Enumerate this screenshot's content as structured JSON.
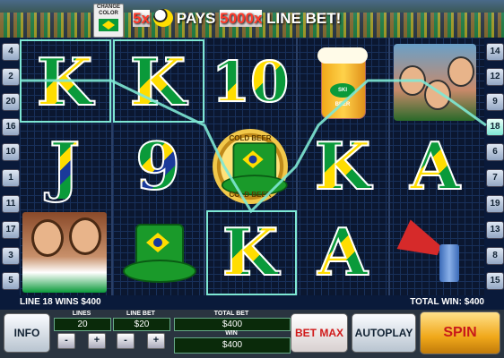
{
  "header": {
    "change_color_label": "CHANGE COLOR",
    "banner_multiplier": "5x",
    "banner_pays": "PAYS",
    "banner_amount": "5000x",
    "banner_suffix": "LINE BET!"
  },
  "paylines": {
    "left": [
      "4",
      "2",
      "20",
      "16",
      "10",
      "1",
      "11",
      "17",
      "3",
      "5"
    ],
    "right": [
      "14",
      "12",
      "9",
      "18",
      "6",
      "7",
      "19",
      "13",
      "8",
      "15"
    ]
  },
  "reels": [
    [
      "K",
      "J",
      "girls-fans"
    ],
    [
      "K",
      "9",
      "green-hat"
    ],
    [
      "10",
      "cold-beer-hat",
      "K"
    ],
    [
      "beer",
      "K",
      "A"
    ],
    [
      "fans",
      "A",
      "vuvuzela"
    ]
  ],
  "coin": {
    "top": "COLD BEER",
    "bottom": "COLD BEER"
  },
  "beer_label": "SKI BEER",
  "status": {
    "line_win": "LINE 18 WINS $400",
    "total_win": "TOTAL WIN: $400"
  },
  "controls": {
    "info": "INFO",
    "lines_label": "LINES",
    "lines_value": "20",
    "line_bet_label": "LINE BET",
    "line_bet_value": "$20",
    "total_bet_label": "TOTAL BET",
    "total_bet_value": "$400",
    "win_label": "WIN",
    "win_value": "$400",
    "bet_max": "BET MAX",
    "autoplay": "AUTOPLAY",
    "spin": "SPIN",
    "minus": "-",
    "plus": "+"
  },
  "colors": {
    "highlight": "#7ee8d4",
    "brazil_green": "#0a9a3a",
    "brazil_yellow": "#ffdd00",
    "brazil_blue": "#1a3a9a"
  }
}
